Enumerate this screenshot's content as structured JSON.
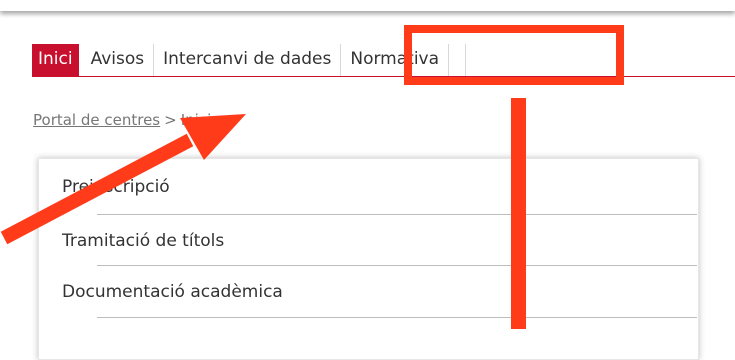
{
  "nav": {
    "tabs": [
      {
        "label": "Inici",
        "active": true
      },
      {
        "label": "Avisos",
        "active": false
      },
      {
        "label": "Intercanvi de dades",
        "active": false
      },
      {
        "label": "Normativa",
        "active": false
      }
    ]
  },
  "breadcrumb": {
    "parent": "Portal de centres",
    "separator": ">",
    "current": "Inici"
  },
  "menu": {
    "items": [
      {
        "label": "Preinscripció"
      },
      {
        "label": "Tramitació de títols"
      },
      {
        "label": "Documentació acadèmica"
      }
    ]
  },
  "colors": {
    "accent": "#c8102e",
    "annotation": "#ff3b1a"
  }
}
